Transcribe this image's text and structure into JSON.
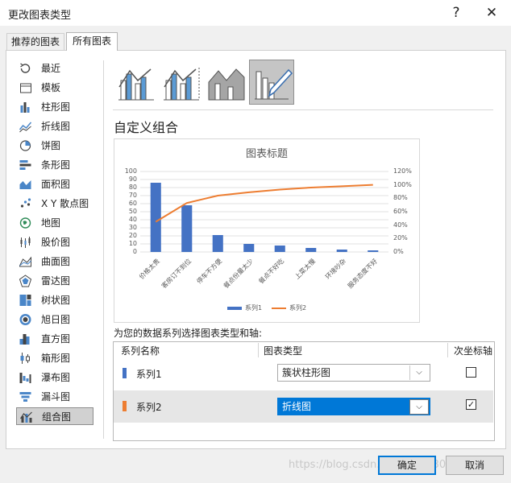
{
  "window": {
    "title": "更改图表类型",
    "help_glyph": "?",
    "close_glyph": "✕"
  },
  "tabs": [
    {
      "label": "推荐的图表",
      "active": false
    },
    {
      "label": "所有图表",
      "active": true
    }
  ],
  "nav": [
    {
      "label": "最近",
      "icon": "recent-icon"
    },
    {
      "label": "模板",
      "icon": "template-folder-icon"
    },
    {
      "label": "柱形图",
      "icon": "column-chart-icon"
    },
    {
      "label": "折线图",
      "icon": "line-chart-icon"
    },
    {
      "label": "饼图",
      "icon": "pie-chart-icon"
    },
    {
      "label": "条形图",
      "icon": "bar-chart-icon"
    },
    {
      "label": "面积图",
      "icon": "area-chart-icon"
    },
    {
      "label": "X Y 散点图",
      "icon": "scatter-chart-icon"
    },
    {
      "label": "地图",
      "icon": "map-chart-icon"
    },
    {
      "label": "股价图",
      "icon": "stock-chart-icon"
    },
    {
      "label": "曲面图",
      "icon": "surface-chart-icon"
    },
    {
      "label": "雷达图",
      "icon": "radar-chart-icon"
    },
    {
      "label": "树状图",
      "icon": "treemap-chart-icon"
    },
    {
      "label": "旭日图",
      "icon": "sunburst-chart-icon"
    },
    {
      "label": "直方图",
      "icon": "histogram-chart-icon"
    },
    {
      "label": "箱形图",
      "icon": "box-whisker-chart-icon"
    },
    {
      "label": "瀑布图",
      "icon": "waterfall-chart-icon"
    },
    {
      "label": "漏斗图",
      "icon": "funnel-chart-icon"
    },
    {
      "label": "组合图",
      "icon": "combo-chart-icon",
      "selected": true
    }
  ],
  "subtypes": [
    {
      "name": "clustered-column-line-icon",
      "selected": false
    },
    {
      "name": "clustered-column-line-secondary-icon",
      "selected": false
    },
    {
      "name": "stacked-area-column-icon",
      "selected": false
    },
    {
      "name": "custom-combination-icon",
      "selected": true
    }
  ],
  "section_title": "自定义组合",
  "chart_data": {
    "type": "bar",
    "title": "图表标题",
    "categories": [
      "价格太贵",
      "客房订不到位",
      "停车不方便",
      "餐点份量太少",
      "餐点不好吃",
      "上菜太慢",
      "环境吵杂",
      "服务态度不好"
    ],
    "series": [
      {
        "name": "系列1",
        "type": "bar",
        "axis": "primary",
        "color": "#4472c4",
        "values": [
          86,
          58,
          21,
          10,
          8,
          5,
          3,
          2
        ]
      },
      {
        "name": "系列2",
        "type": "line",
        "axis": "secondary",
        "color": "#ed7d31",
        "values": [
          0.45,
          0.73,
          0.84,
          0.89,
          0.93,
          0.96,
          0.98,
          1.0
        ]
      }
    ],
    "ylim": [
      0,
      100
    ],
    "yticks": [
      "0",
      "10",
      "20",
      "30",
      "40",
      "50",
      "60",
      "70",
      "80",
      "90",
      "100"
    ],
    "y2lim": [
      0,
      1.2
    ],
    "y2ticks": [
      "0%",
      "20%",
      "40%",
      "60%",
      "80%",
      "100%",
      "120%"
    ],
    "grid": true,
    "legend": "bottom"
  },
  "instruction": "为您的数据系列选择图表类型和轴:",
  "table": {
    "headers": [
      "系列名称",
      "图表类型",
      "次坐标轴"
    ],
    "rows": [
      {
        "name": "系列1",
        "color": "#4472c4",
        "chart_type": "簇状柱形图",
        "secondary": false,
        "secondary_glyph": ""
      },
      {
        "name": "系列2",
        "color": "#ed7d31",
        "chart_type": "折线图",
        "secondary": true,
        "secondary_glyph": "✓"
      }
    ],
    "dropdown_glyph": "⌵"
  },
  "buttons": {
    "ok": "确定",
    "cancel": "取消"
  },
  "watermark": "https://blog.csdn.net/qq_23308664"
}
